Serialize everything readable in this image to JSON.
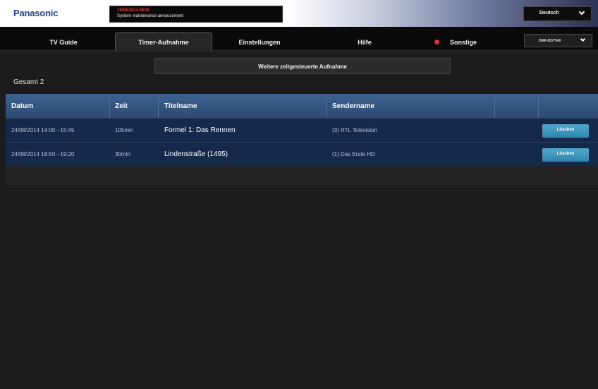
{
  "header": {
    "logo": "Panasonic",
    "notice_date": "19/08/2014 NEW",
    "notice_text": "System maintenance annoucement",
    "language": "Deutsch"
  },
  "tabs": [
    {
      "label": "TV Guide",
      "active": false
    },
    {
      "label": "Timer-Aufnahme",
      "active": true
    },
    {
      "label": "Einstellungen",
      "active": false
    },
    {
      "label": "Hilfe",
      "active": false
    },
    {
      "label": "Sonstige",
      "active": false
    }
  ],
  "device_selector": "DMR-BST940",
  "main": {
    "add_button": "Weitere zeitgesteuerte Aufnahme",
    "total": "Gesamt 2",
    "columns": [
      "Datum",
      "Zeit",
      "Titelname",
      "Sendername"
    ],
    "rows": [
      {
        "date": "24/08/2014 14:00 - 15:45",
        "duration": "105min",
        "title": "Formel 1: Das Rennen",
        "channel": "(3) RTL Television",
        "action": "Löschen"
      },
      {
        "date": "24/08/2014 18:50 - 19:20",
        "duration": "30min",
        "title": "Lindenstraße (1495)",
        "channel": "(1) Das Erste HD",
        "action": "Löschen"
      }
    ]
  },
  "colors": {
    "brand": "#1b3f9b",
    "header_row": "#3f6290",
    "data_row": "#15294a",
    "delete_button": "#3a95bf",
    "alert": "#e5332a"
  }
}
